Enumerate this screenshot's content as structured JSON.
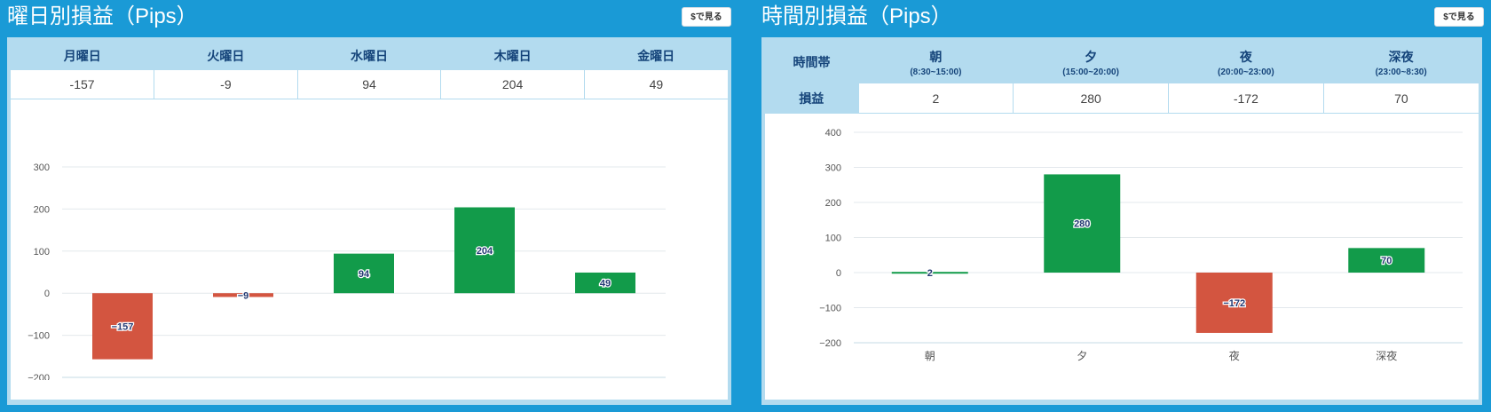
{
  "left_panel": {
    "title": "曜日別損益（Pips）",
    "button_label": "$で見る",
    "table": {
      "headers": [
        "月曜日",
        "火曜日",
        "水曜日",
        "木曜日",
        "金曜日"
      ],
      "values": [
        "-157",
        "-9",
        "94",
        "204",
        "49"
      ]
    }
  },
  "right_panel": {
    "title": "時間別損益（Pips）",
    "button_label": "$で見る",
    "table": {
      "row_header_label": "時間帯",
      "value_row_label": "損益",
      "headers": [
        {
          "label": "朝",
          "sub": "(8:30~15:00)"
        },
        {
          "label": "夕",
          "sub": "(15:00~20:00)"
        },
        {
          "label": "夜",
          "sub": "(20:00~23:00)"
        },
        {
          "label": "深夜",
          "sub": "(23:00~8:30)"
        }
      ],
      "values": [
        "2",
        "280",
        "-172",
        "70"
      ]
    }
  },
  "colors": {
    "background": "#1a9ad6",
    "positive": "#129b4a",
    "negative": "#d35540",
    "axis_text": "#555555",
    "grid": "#e3e8ec"
  },
  "chart_data": [
    {
      "type": "bar",
      "categories": [
        "月",
        "火",
        "水",
        "木",
        "金"
      ],
      "values": [
        -157,
        -9,
        94,
        204,
        49
      ],
      "ylim": [
        -200,
        300
      ],
      "yticks": [
        -200,
        -100,
        0,
        100,
        200,
        300
      ],
      "ytick_labels": [
        "−200",
        "−100",
        "0",
        "100",
        "200",
        "300"
      ],
      "data_labels": [
        "−157",
        "−9",
        "94",
        "204",
        "49"
      ],
      "grid": true
    },
    {
      "type": "bar",
      "categories": [
        "朝",
        "夕",
        "夜",
        "深夜"
      ],
      "values": [
        2,
        280,
        -172,
        70
      ],
      "ylim": [
        -200,
        400
      ],
      "yticks": [
        -200,
        -100,
        0,
        100,
        200,
        300,
        400
      ],
      "ytick_labels": [
        "−200",
        "−100",
        "0",
        "100",
        "200",
        "300",
        "400"
      ],
      "data_labels": [
        "2",
        "280",
        "−172",
        "70"
      ],
      "grid": true
    }
  ]
}
